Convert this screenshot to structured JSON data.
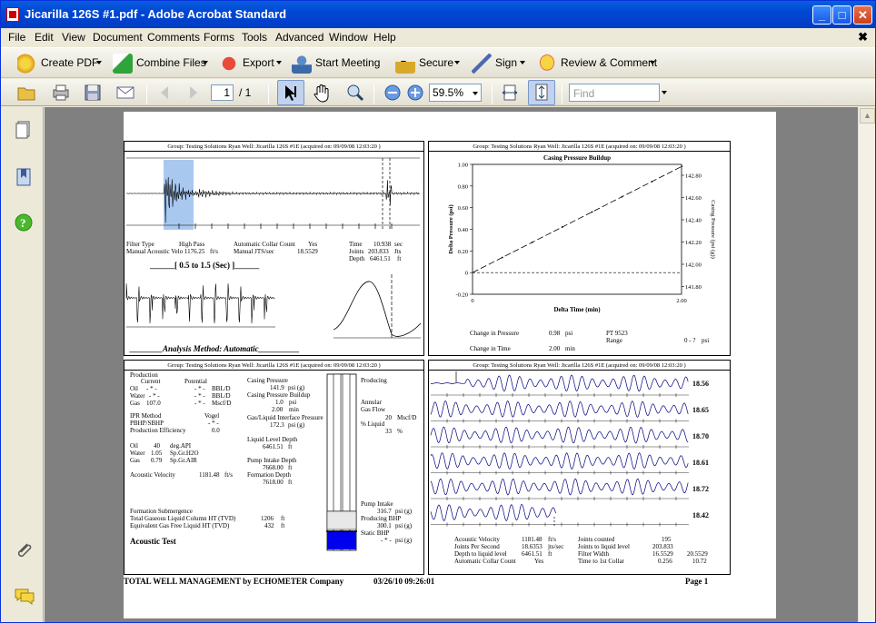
{
  "window": {
    "title": "Jicarilla 126S #1.pdf - Adobe Acrobat Standard",
    "min": "_",
    "max": "□",
    "close": "✕"
  },
  "menu": [
    "File",
    "Edit",
    "View",
    "Document",
    "Comments",
    "Forms",
    "Tools",
    "Advanced",
    "Window",
    "Help"
  ],
  "menu_close": "✖",
  "toolbar1": {
    "create_pdf": "Create PDF",
    "combine": "Combine Files",
    "export": "Export",
    "meeting": "Start Meeting",
    "secure": "Secure",
    "sign": "Sign",
    "review": "Review & Comment"
  },
  "toolbar2": {
    "page_current": "1",
    "page_total": "/ 1",
    "zoom": "59.5%",
    "find_placeholder": "Find"
  },
  "report": {
    "header": "Group: Testing Solutions Ryan     Well: Jicarilla 126S #1E (acquired on: 09/09/08 12:03:20 )",
    "p1": {
      "filter_type": "Filter Type",
      "high_pass": "High Pass",
      "auto_collar": "Automatic Collar Count",
      "yes": "Yes",
      "time_label": "Time",
      "time_val": "10.938",
      "time_unit": "sec",
      "acoustic_velo": "Manual Acoustic Velo 1176.25",
      "fts": "ft/s",
      "manual_jts": "Manual JTS/sec",
      "jts_val": "18.5529",
      "joints_label": "Joints",
      "joints_val": "203.833",
      "joints_unit": "Jts",
      "depth_label": "Depth",
      "depth_val": "6461.51",
      "depth_unit": "ft",
      "window": "______[ 0.5  to  1.5 (Sec) ]______",
      "analysis": "________Analysis Method:    Automatic__________"
    },
    "p2": {
      "title": "Casing Pressure Buildup",
      "ylabel": "Delta Pressure (psi)",
      "ylabel2": "Casing Pressure (psi (g))",
      "xlabel": "Delta Time (min)",
      "yticks": [
        "1.00",
        "0.80",
        "0.60",
        "0.40",
        "0.20",
        "0",
        "-0.20"
      ],
      "yticks2": [
        "142.80",
        "142.60",
        "142.40",
        "142.20",
        "142.00",
        "141.80"
      ],
      "xticks": [
        "0",
        "2.00"
      ],
      "cp_label": "Change in Pressure",
      "cp_val": "0.98",
      "cp_unit": "psi",
      "ct_label": "Change in Time",
      "ct_val": "2.00",
      "ct_unit": "min",
      "pt": "PT 9523",
      "range": "Range",
      "range_val": "0 - ?",
      "range_unit": "psi"
    },
    "p3": {
      "production": "Production",
      "current": "Current",
      "potential": "Potential",
      "oil": "Oil",
      "oil_cur": "- * -",
      "oil_pot": "- * -",
      "oil_unit": "BBL/D",
      "water": "Water",
      "water_cur": "- * -",
      "water_pot": "- * -",
      "water_unit": "BBL/D",
      "gas": "Gas",
      "gas_cur": "107.0",
      "gas_pot": "- * -",
      "gas_unit": "Mscf/D",
      "ipr": "IPR Method",
      "vogel": "Vogel",
      "pbhp": "PBHP/SBHP",
      "pbhp_val": "- * -",
      "prod_eff": "Production Efficiency",
      "prod_eff_val": "0.0",
      "oil2": "Oil",
      "oil2_val": "40",
      "oil2_unit": "deg.API",
      "water2": "Water",
      "water2_val": "1.05",
      "water2_unit": "Sp.Gr.H2O",
      "gas2": "Gas",
      "gas2_val": "0.79",
      "gas2_unit": "Sp.Gr.AIR",
      "acoustic_velocity": "Acoustic Velocity",
      "av_val": "1181.48",
      "av_unit": "ft/s",
      "casing_pressure": "Casing Pressure",
      "cp_val": "141.9",
      "cp_unit": "psi (g)",
      "cpb": "Casing Pressure Buildup",
      "cpb_val": "1.0",
      "cpb_unit": "psi",
      "cpb_time": "2.00",
      "cpb_time_unit": "min",
      "glip": "Gas/Liquid Interface Pressure",
      "glip_val": "172.3",
      "glip_unit": "psi (g)",
      "lld": "Liquid Level Depth",
      "lld_val": "6461.51",
      "lld_unit": "ft",
      "pid": "Pump Intake Depth",
      "pid_val": "7668.00",
      "pid_unit": "ft",
      "fd": "Formation Depth",
      "fd_val": "7618.00",
      "fd_unit": "ft",
      "producing": "Producing",
      "annular": "Annular",
      "gas_flow": "Gas Flow",
      "gas_flow_val": "20",
      "gas_flow_unit": "Mscf/D",
      "pct_liquid": "% Liquid",
      "pct_liquid_val": "33",
      "pct_unit": "%",
      "fs": "Formation Submergence",
      "tglc": "Total Gaseous Liquid Column HT (TVD)",
      "tglc_val": "1206",
      "tglc_unit": "ft",
      "egfl": "Equivalent Gas Free Liquid HT (TVD)",
      "egfl_val": "432",
      "egfl_unit": "ft",
      "pump_intake": "Pump Intake",
      "pi_val": "316.7",
      "pi_unit": "psi (g)",
      "pbhp2": "Producing BHP",
      "pbhp2_val": "300.1",
      "pbhp2_unit": "psi (g)",
      "sbhp": "Static BHP",
      "sbhp_val": "- * -",
      "sbhp_unit": "psi (g)",
      "acoustic_test": "Acoustic Test"
    },
    "p4": {
      "rates": [
        "18.56",
        "18.65",
        "18.70",
        "18.61",
        "18.72",
        "18.42"
      ],
      "av": "Acoustic Velocity",
      "av_val": "1181.48",
      "av_unit": "ft/s",
      "jps": "Joints Per Second",
      "jps_val": "18.6353",
      "jps_unit": "jts/sec",
      "dtl": "Depth to liquid level",
      "dtl_val": "6461.51",
      "dtl_unit": "ft",
      "acc": "Automatic Collar Count",
      "acc_val": "Yes",
      "jc": "Joints counted",
      "jc_val": "195",
      "jtl": "Joints to liquid level",
      "jtl_val": "203.833",
      "fw": "Filter Width",
      "fw_val1": "16.5529",
      "fw_val2": "20.5529",
      "t1c": "Time to 1st Collar",
      "t1c_val1": "0.256",
      "t1c_val2": "10.72"
    },
    "footer_left": "TOTAL WELL MANAGEMENT   by ECHOMETER Company",
    "footer_date": "03/26/10 09:26:01",
    "footer_page": "Page 1"
  }
}
